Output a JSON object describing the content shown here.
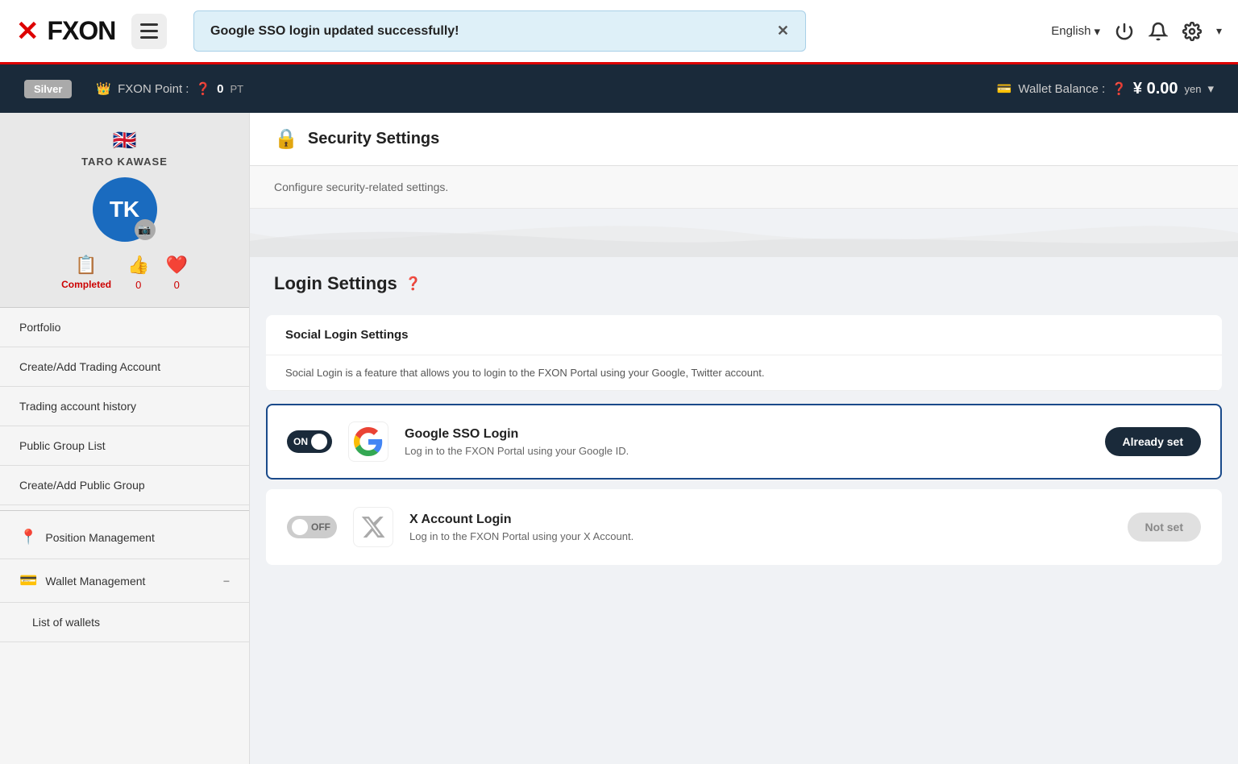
{
  "header": {
    "logo": "FXON",
    "logo_x": "✕",
    "notification": "Google SSO login updated successfully!",
    "language": "English",
    "language_arrow": "▾"
  },
  "subheader": {
    "badge": "Silver",
    "fxon_point_label": "FXON Point :",
    "fxon_point_value": "0",
    "fxon_point_unit": "PT",
    "wallet_label": "Wallet Balance :",
    "wallet_value": "¥ 0.00",
    "wallet_unit": "yen",
    "wallet_arrow": "▾"
  },
  "sidebar": {
    "flag": "🇬🇧",
    "user_name": "TARO KAWASE",
    "avatar_initials": "TK",
    "stats": [
      {
        "label": "Completed",
        "value": ""
      },
      {
        "label": "0",
        "value": "0"
      },
      {
        "label": "0",
        "value": "0"
      }
    ],
    "nav_items": [
      "Portfolio",
      "Create/Add Trading Account",
      "Trading account history",
      "Public Group List",
      "Create/Add Public Group"
    ],
    "sections": [
      {
        "label": "Position Management",
        "icon": "📍"
      },
      {
        "label": "Wallet Management",
        "icon": "💳",
        "has_minus": true
      },
      {
        "label": "List of wallets",
        "icon": ""
      }
    ]
  },
  "content": {
    "section_title": "Security Settings",
    "description": "Configure security-related settings.",
    "login_settings_title": "Login Settings",
    "social_login_subtitle": "Social Login Settings",
    "social_login_description": "Social Login is a feature that allows you to login to the FXON Portal using your Google, Twitter account.",
    "google_sso": {
      "title": "Google SSO Login",
      "description": "Log in to the FXON Portal using your Google ID.",
      "toggle_state": "ON",
      "status_label": "Already set"
    },
    "x_account": {
      "title": "X Account Login",
      "description": "Log in to the FXON Portal using your X Account.",
      "toggle_state": "OFF",
      "status_label": "Not set"
    }
  }
}
